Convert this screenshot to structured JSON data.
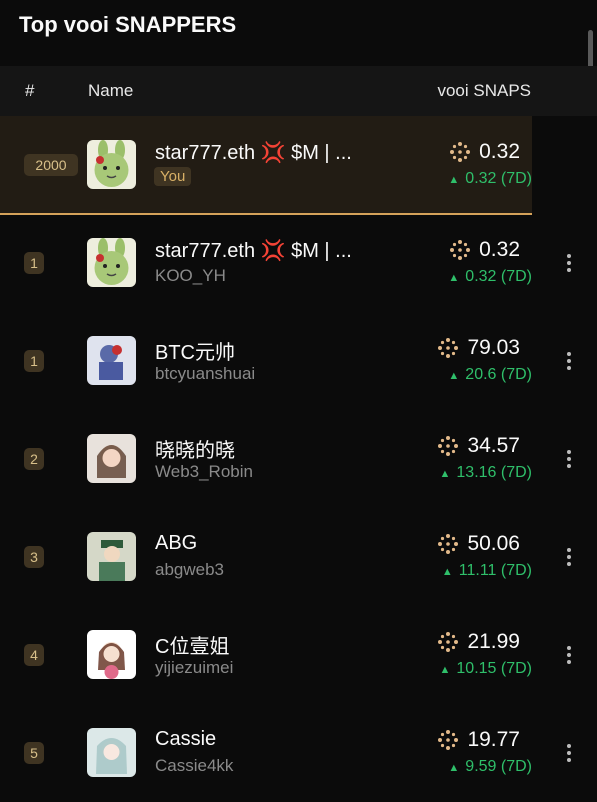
{
  "title": "Top vooi SNAPPERS",
  "header": {
    "rank": "#",
    "name": "Name",
    "snaps": "vooi SNAPS"
  },
  "you_row": {
    "rank": "2000",
    "name": "star777.eth 💢 $M | ...",
    "badge": "You",
    "snaps": "0.32",
    "delta": "0.32 (7D)"
  },
  "rows": [
    {
      "rank": "1",
      "name": "star777.eth 💢 $M | ...",
      "handle": "KOO_YH",
      "snaps": "0.32",
      "delta": "0.32 (7D)"
    },
    {
      "rank": "1",
      "name": "BTC元帅",
      "handle": "btcyuanshuai",
      "snaps": "79.03",
      "delta": "20.6 (7D)"
    },
    {
      "rank": "2",
      "name": "晓晓的晓",
      "handle": "Web3_Robin",
      "snaps": "34.57",
      "delta": "13.16 (7D)"
    },
    {
      "rank": "3",
      "name": "ABG",
      "handle": "abgweb3",
      "snaps": "50.06",
      "delta": "11.11 (7D)"
    },
    {
      "rank": "4",
      "name": "C位壹姐",
      "handle": "yijiezuimei",
      "snaps": "21.99",
      "delta": "10.15 (7D)"
    },
    {
      "rank": "5",
      "name": "Cassie",
      "handle": "Cassie4kk",
      "snaps": "19.77",
      "delta": "9.59 (7D)"
    }
  ],
  "colors": {
    "accent": "#d5a25a",
    "positive": "#2fbf6a",
    "rank_badge_bg": "#3f3422"
  },
  "icons": {
    "snaps": "vooi-snap-icon",
    "more": "more-vertical-icon",
    "up": "up-triangle-icon"
  }
}
